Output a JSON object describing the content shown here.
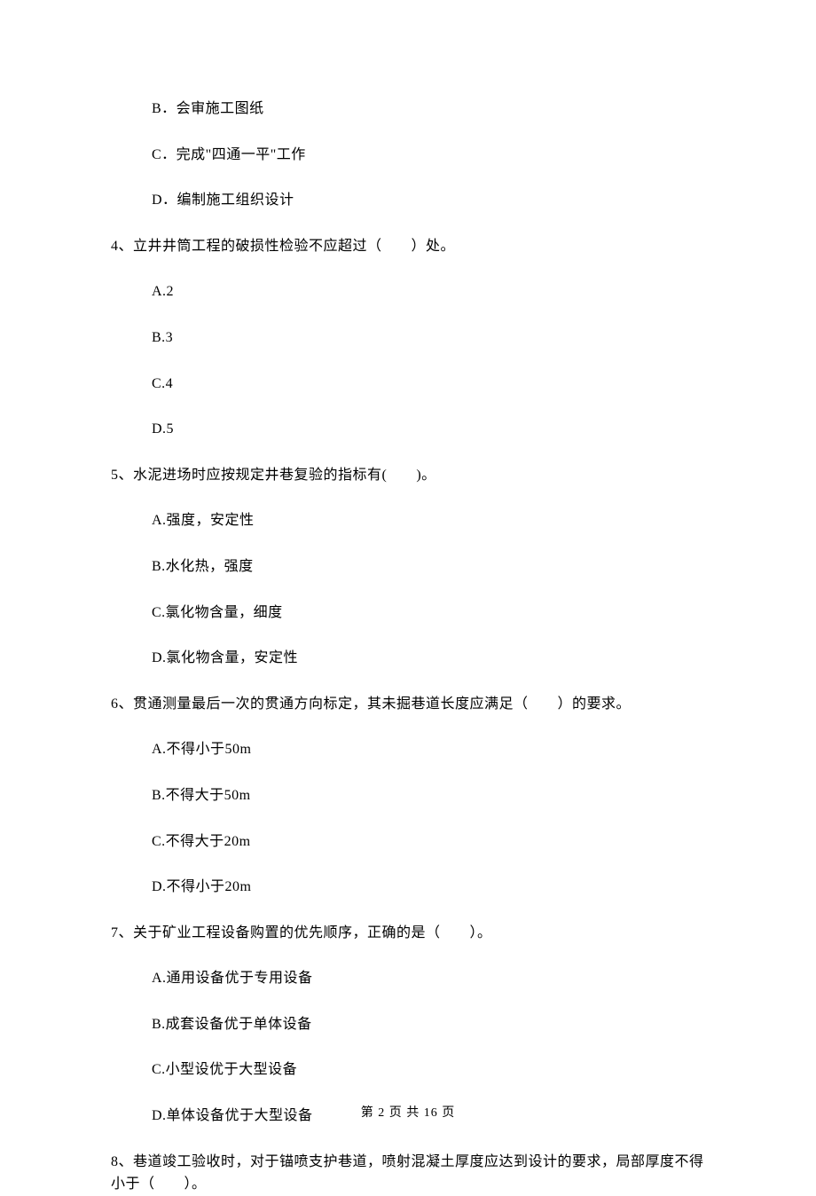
{
  "q3": {
    "optB": "B．会审施工图纸",
    "optC": "C．完成\"四通一平\"工作",
    "optD": "D．编制施工组织设计"
  },
  "q4": {
    "stem": "4、立井井筒工程的破损性检验不应超过（　　）处。",
    "optA": "A.2",
    "optB": "B.3",
    "optC": "C.4",
    "optD": "D.5"
  },
  "q5": {
    "stem": "5、水泥进场时应按规定井巷复验的指标有(　　)。",
    "optA": "A.强度，安定性",
    "optB": "B.水化热，强度",
    "optC": "C.氯化物含量，细度",
    "optD": "D.氯化物含量，安定性"
  },
  "q6": {
    "stem": "6、贯通测量最后一次的贯通方向标定，其未掘巷道长度应满足（　　）的要求。",
    "optA": "A.不得小于50m",
    "optB": "B.不得大于50m",
    "optC": "C.不得大于20m",
    "optD": "D.不得小于20m"
  },
  "q7": {
    "stem": "7、关于矿业工程设备购置的优先顺序，正确的是（　　）。",
    "optA": "A.通用设备优于专用设备",
    "optB": "B.成套设备优于单体设备",
    "optC": "C.小型设优于大型设备",
    "optD": "D.单体设备优于大型设备"
  },
  "q8": {
    "stem": "8、巷道竣工验收时，对于锚喷支护巷道，喷射混凝土厚度应达到设计的要求，局部厚度不得小于（　　）。"
  },
  "footer": "第 2 页 共 16 页"
}
